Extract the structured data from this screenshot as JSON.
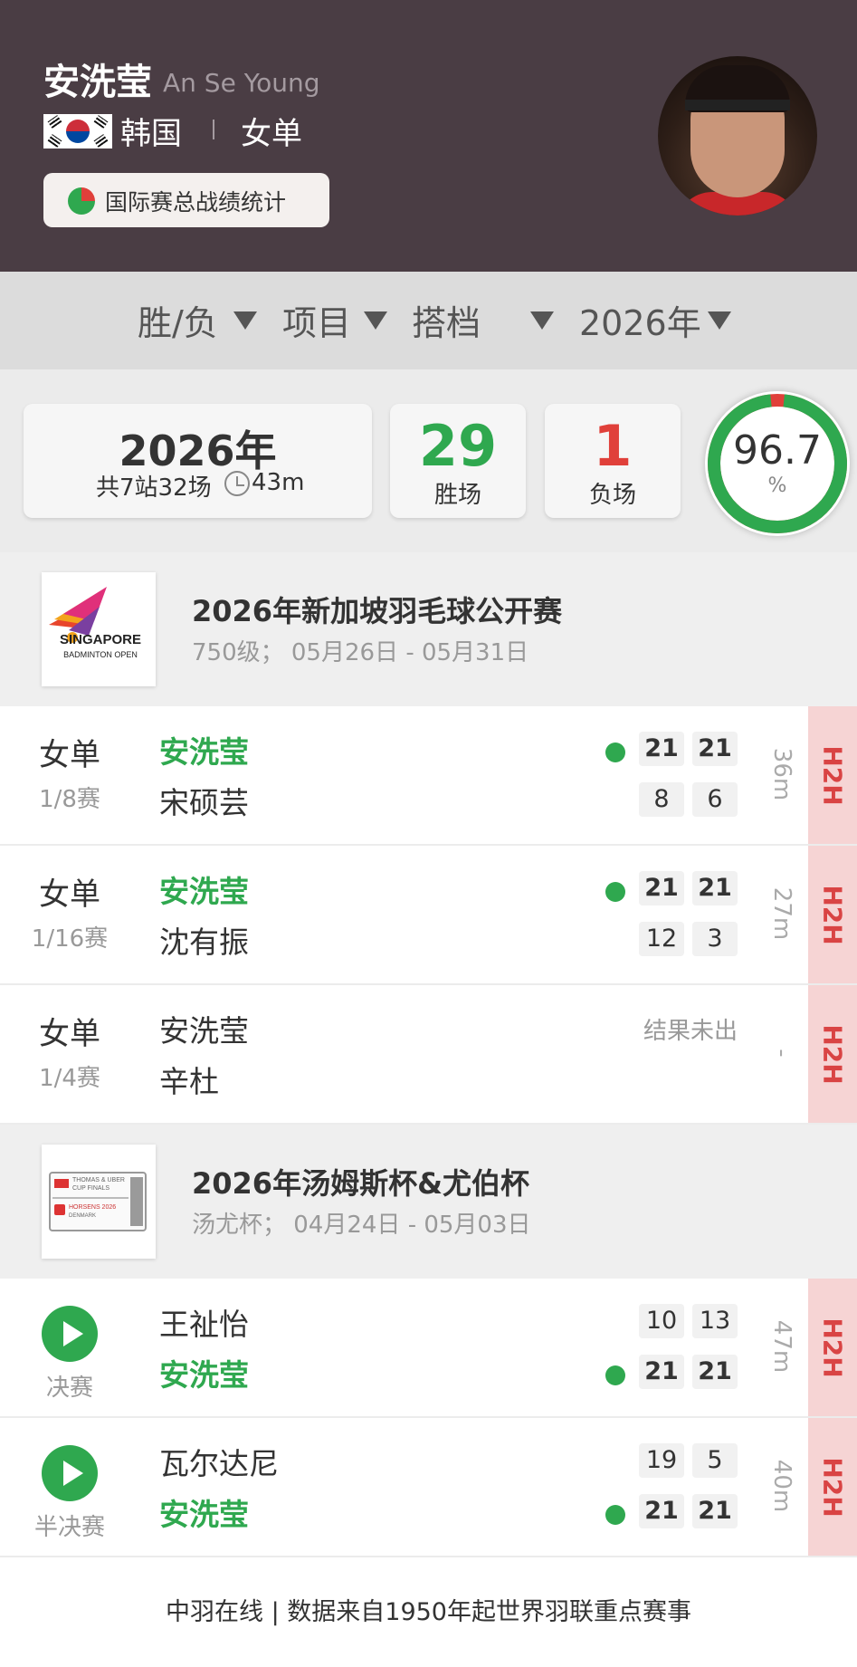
{
  "player": {
    "name_cn": "安洗莹",
    "name_en": "An Se Young",
    "country": "韩国",
    "separator": "|",
    "event": "女单",
    "stats_button": "国际赛总战绩统计"
  },
  "filters": [
    {
      "label": "胜/负"
    },
    {
      "label": "项目"
    },
    {
      "label": "搭档"
    },
    {
      "label": "2026年"
    }
  ],
  "summary": {
    "year": "2026年",
    "sub": "共7站32场",
    "avg_time": "43m",
    "wins": "29",
    "wins_label": "胜场",
    "losses": "1",
    "losses_label": "负场",
    "win_rate": "96.7",
    "win_rate_unit": "%",
    "win_rate_fraction": 0.967
  },
  "tournaments": [
    {
      "title": "2026年新加坡羽毛球公开赛",
      "sub": "750级； 05月26日 - 05月31日",
      "logo_text1": "SINGAPORE",
      "logo_text2": "BADMINTON OPEN",
      "matches": [
        {
          "category": "女单",
          "round": "1/8赛",
          "p1": "安洗莹",
          "p2": "宋硕芸",
          "s1": [
            "21",
            "21"
          ],
          "s2": [
            "8",
            "6"
          ],
          "duration": "36m",
          "h2h": "H2H"
        },
        {
          "category": "女单",
          "round": "1/16赛",
          "p1": "安洗莹",
          "p2": "沈有振",
          "s1": [
            "21",
            "21"
          ],
          "s2": [
            "12",
            "3"
          ],
          "duration": "27m",
          "h2h": "H2H"
        },
        {
          "category": "女单",
          "round": "1/4赛",
          "p1": "安洗莹",
          "p2": "辛杜",
          "pending": "结果未出",
          "duration": "-",
          "h2h": "H2H"
        }
      ]
    },
    {
      "title": "2026年汤姆斯杯&尤伯杯",
      "sub": "汤尤杯； 04月24日 - 05月03日",
      "logo_text1": "THOMAS & UBER",
      "logo_text2": "CUP FINALS",
      "logo_text3": "HORSENS 2026",
      "logo_text4": "DENMARK",
      "matches": [
        {
          "round": "决赛",
          "p1": "王祉怡",
          "p2": "安洗莹",
          "s1": [
            "10",
            "13"
          ],
          "s2": [
            "21",
            "21"
          ],
          "duration": "47m",
          "h2h": "H2H"
        },
        {
          "round": "半决赛",
          "p1": "瓦尔达尼",
          "p2": "安洗莹",
          "s1": [
            "19",
            "5"
          ],
          "s2": [
            "21",
            "21"
          ],
          "duration": "40m",
          "h2h": "H2H"
        }
      ]
    }
  ],
  "footer": "中羽在线 | 数据来自1950年起世界羽联重点赛事",
  "colors": {
    "header_bg": "#4a3d44",
    "win_green": "#2fa84f",
    "loss_red": "#e0403a",
    "h2h_bg": "#f6d4d4"
  }
}
